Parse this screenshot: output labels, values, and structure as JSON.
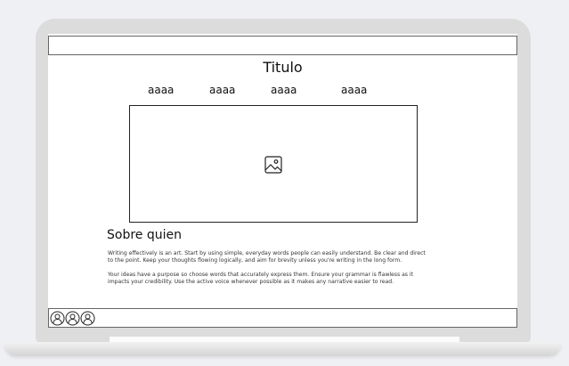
{
  "page": {
    "title": "Titulo",
    "nav": [
      "aaaa",
      "aaaa",
      "aaaa",
      "aaaa"
    ],
    "about": {
      "heading": "Sobre quien",
      "paragraphs": [
        "Writing effectively is an art. Start by using simple, everyday words people can easily understand. Be clear and direct to the point. Keep your thoughts flowing logically, and aim for brevity unless you're writing in the long form.",
        "Your ideas have a purpose so choose words that accurately express them. Ensure your grammar is flawless as it impacts your credibility. Use the active voice whenever possible as it makes any narrative easier to read."
      ]
    }
  },
  "icons": {
    "image": "image-placeholder-icon",
    "footer": [
      "user-icon",
      "user-icon",
      "user-icon"
    ]
  }
}
